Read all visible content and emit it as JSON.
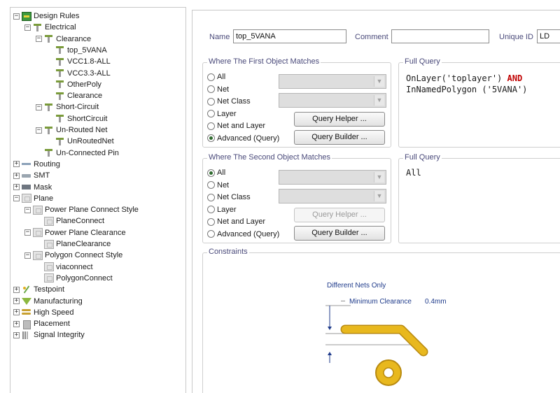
{
  "tree": {
    "items": [
      {
        "label": "Design Rules",
        "icon": "design-rules-icon"
      },
      {
        "label": "Electrical",
        "icon": "rule-icon"
      },
      {
        "label": "Clearance",
        "icon": "rule-icon"
      },
      {
        "label": "top_5VANA",
        "icon": "rule-icon"
      },
      {
        "label": "VCC1.8-ALL",
        "icon": "rule-icon"
      },
      {
        "label": "VCC3.3-ALL",
        "icon": "rule-icon"
      },
      {
        "label": "OtherPoly",
        "icon": "rule-icon"
      },
      {
        "label": "Clearance",
        "icon": "rule-icon"
      },
      {
        "label": "Short-Circuit",
        "icon": "rule-icon"
      },
      {
        "label": "ShortCircuit",
        "icon": "rule-icon"
      },
      {
        "label": "Un-Routed Net",
        "icon": "rule-icon"
      },
      {
        "label": "UnRoutedNet",
        "icon": "rule-icon"
      },
      {
        "label": "Un-Connected Pin",
        "icon": "rule-icon"
      },
      {
        "label": "Routing",
        "icon": "routing-icon"
      },
      {
        "label": "SMT",
        "icon": "smt-icon"
      },
      {
        "label": "Mask",
        "icon": "mask-icon"
      },
      {
        "label": "Plane",
        "icon": "plane-icon"
      },
      {
        "label": "Power Plane Connect Style",
        "icon": "plane-icon"
      },
      {
        "label": "PlaneConnect",
        "icon": "plane-icon"
      },
      {
        "label": "Power Plane Clearance",
        "icon": "plane-icon"
      },
      {
        "label": "PlaneClearance",
        "icon": "plane-icon"
      },
      {
        "label": "Polygon Connect Style",
        "icon": "plane-icon"
      },
      {
        "label": "viaconnect",
        "icon": "plane-icon"
      },
      {
        "label": "PolygonConnect",
        "icon": "plane-icon"
      },
      {
        "label": "Testpoint",
        "icon": "testpoint-icon"
      },
      {
        "label": "Manufacturing",
        "icon": "manufacturing-icon"
      },
      {
        "label": "High Speed",
        "icon": "high-speed-icon"
      },
      {
        "label": "Placement",
        "icon": "placement-icon"
      },
      {
        "label": "Signal Integrity",
        "icon": "signal-integrity-icon"
      }
    ],
    "expanders": [
      "−",
      "+"
    ]
  },
  "header": {
    "name_label": "Name",
    "name_value": "top_5VANA",
    "comment_label": "Comment",
    "comment_value": "",
    "uid_label": "Unique ID",
    "uid_value": "LD"
  },
  "first": {
    "title": "Where The First Object Matches",
    "options": [
      "All",
      "Net",
      "Net Class",
      "Layer",
      "Net and Layer",
      "Advanced (Query)"
    ],
    "selected": "Advanced (Query)",
    "query_helper": "Query Helper ...",
    "query_builder": "Query Builder ...",
    "full_query_title": "Full Query",
    "query_line1_a": "OnLayer('toplayer') ",
    "query_line1_kw": "AND",
    "query_line2": "InNamedPolygon ('5VANA')"
  },
  "second": {
    "title": "Where The Second Object Matches",
    "options": [
      "All",
      "Net",
      "Net Class",
      "Layer",
      "Net and Layer",
      "Advanced (Query)"
    ],
    "selected": "All",
    "query_helper": "Query Helper ...",
    "query_builder": "Query Builder ...",
    "full_query_title": "Full Query",
    "query_line1": "All"
  },
  "constraints": {
    "title": "Constraints",
    "nets_mode": "Different Nets Only",
    "min_clearance_label": "Minimum Clearance",
    "min_clearance_value": "0.4mm"
  },
  "colors": {
    "accent": "#4a4a7a",
    "track": "#e8b81e",
    "track_outline": "#b88a10",
    "keyword": "#c00000"
  }
}
